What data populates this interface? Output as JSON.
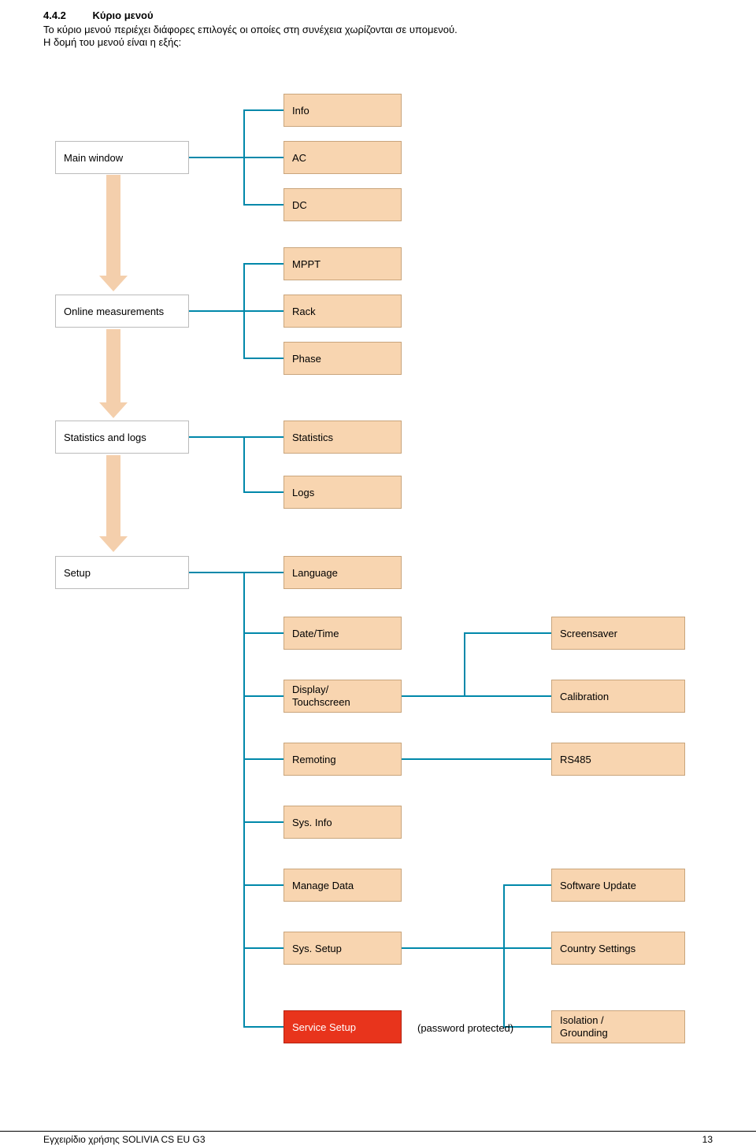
{
  "heading": {
    "num": "4.4.2",
    "title": "Κύριο μενού"
  },
  "para1": "Το κύριο μενού περιέχει διάφορες επιλογές οι οποίες στη συνέχεια χωρίζονται σε υπομενού.",
  "para2": "Η δομή του μενού είναι η εξής:",
  "nodes": {
    "main_window": "Main window",
    "info": "Info",
    "ac": "AC",
    "dc": "DC",
    "online_meas": "Online measurements",
    "mppt": "MPPT",
    "rack": "Rack",
    "phase": "Phase",
    "stats_logs": "Statistics and logs",
    "statistics": "Statistics",
    "logs": "Logs",
    "setup": "Setup",
    "language": "Language",
    "date_time": "Date/Time",
    "display_touch": "Display/\nTouchscreen",
    "remoting": "Remoting",
    "sys_info": "Sys. Info",
    "manage_data": "Manage Data",
    "sys_setup": "Sys. Setup",
    "service_setup": "Service Setup",
    "screensaver": "Screensaver",
    "calibration": "Calibration",
    "rs485": "RS485",
    "software_update": "Software Update",
    "country_settings": "Country Settings",
    "isolation_grounding": "Isolation /\nGrounding"
  },
  "password_note": "(password protected)",
  "footer": {
    "left": "Εγχειρίδιο χρήσης SOLIVIA CS EU G3",
    "right": "13"
  }
}
